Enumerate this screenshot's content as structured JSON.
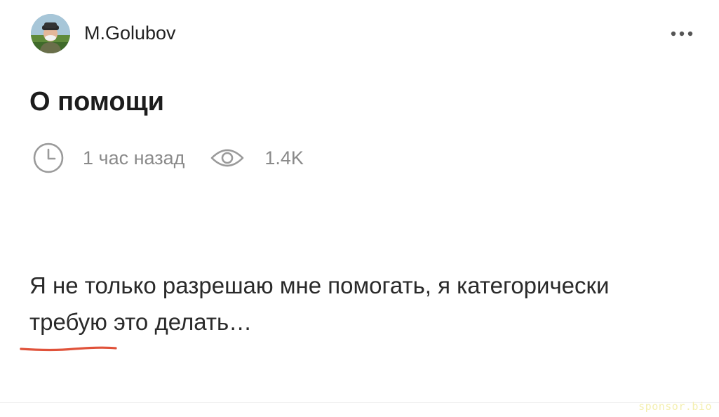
{
  "author": {
    "name": "M.Golubov",
    "avatar_icon": "user-photo-avatar"
  },
  "menu": {
    "icon": "more-horizontal-icon"
  },
  "post": {
    "title": "О помощи",
    "time_icon": "clock-icon",
    "time_ago": "1 час назад",
    "views_icon": "eye-icon",
    "views": "1.4K",
    "body_part1": "Я не только разрешаю мне помогать, я категорически ",
    "body_highlight": "требую",
    "body_part2": " это делать…",
    "highlight_color": "#e0523a"
  },
  "watermark": "sponsor.bio"
}
